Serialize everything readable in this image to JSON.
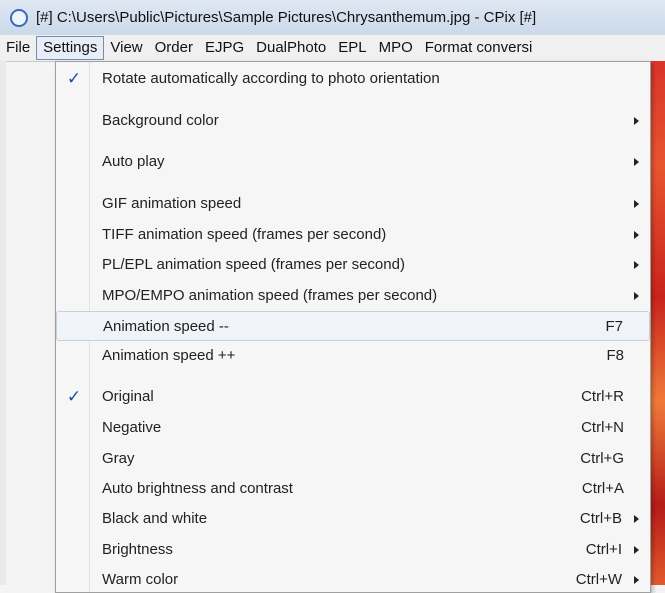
{
  "window": {
    "title": "[#] C:\\Users\\Public\\Pictures\\Sample Pictures\\Chrysanthemum.jpg - CPix [#]"
  },
  "menubar": [
    "File",
    "Settings",
    "View",
    "Order",
    "EJPG",
    "DualPhoto",
    "EPL",
    "MPO",
    "Format conversi"
  ],
  "menu": {
    "rotate": "Rotate automatically according to photo orientation",
    "bg_color": "Background color",
    "auto_play": "Auto play",
    "gif_speed": "GIF animation speed",
    "tiff_speed": "TIFF animation speed (frames per second)",
    "pl_speed": "PL/EPL animation speed (frames per second)",
    "mpo_speed": "MPO/EMPO animation speed (frames per second)",
    "anim_minus": "Animation speed --",
    "anim_minus_key": "F7",
    "anim_plus": "Animation speed ++",
    "anim_plus_key": "F8",
    "original": "Original",
    "original_key": "Ctrl+R",
    "negative": "Negative",
    "negative_key": "Ctrl+N",
    "gray": "Gray",
    "gray_key": "Ctrl+G",
    "auto_bc": "Auto brightness and contrast",
    "auto_bc_key": "Ctrl+A",
    "bw": "Black and white",
    "bw_key": "Ctrl+B",
    "brightness": "Brightness",
    "brightness_key": "Ctrl+I",
    "warm": "Warm color",
    "warm_key": "Ctrl+W",
    "checkmark": "✓"
  }
}
